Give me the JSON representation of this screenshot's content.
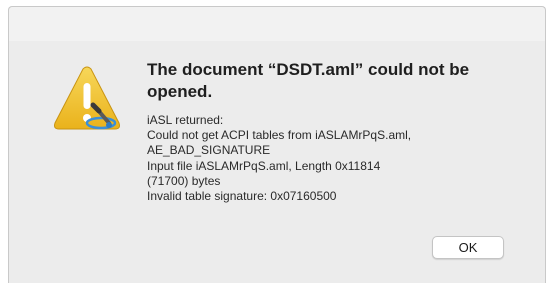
{
  "dialog": {
    "title": "The document “DSDT.aml” could not be opened.",
    "message_lines": [
      "iASL returned:",
      "Could not get ACPI tables from iASLAMrPqS.aml,",
      "AE_BAD_SIGNATURE",
      "Input file iASLAMrPqS.aml, Length 0x11814",
      "(71700) bytes",
      "Invalid table signature: 0x07160500"
    ],
    "ok_label": "OK",
    "icon": "warning-triangle-with-app-badge-icon"
  },
  "colors": {
    "window_background": "#ececec",
    "warning_yellow": "#f2c230",
    "badge_blue": "#3b8fd8"
  }
}
